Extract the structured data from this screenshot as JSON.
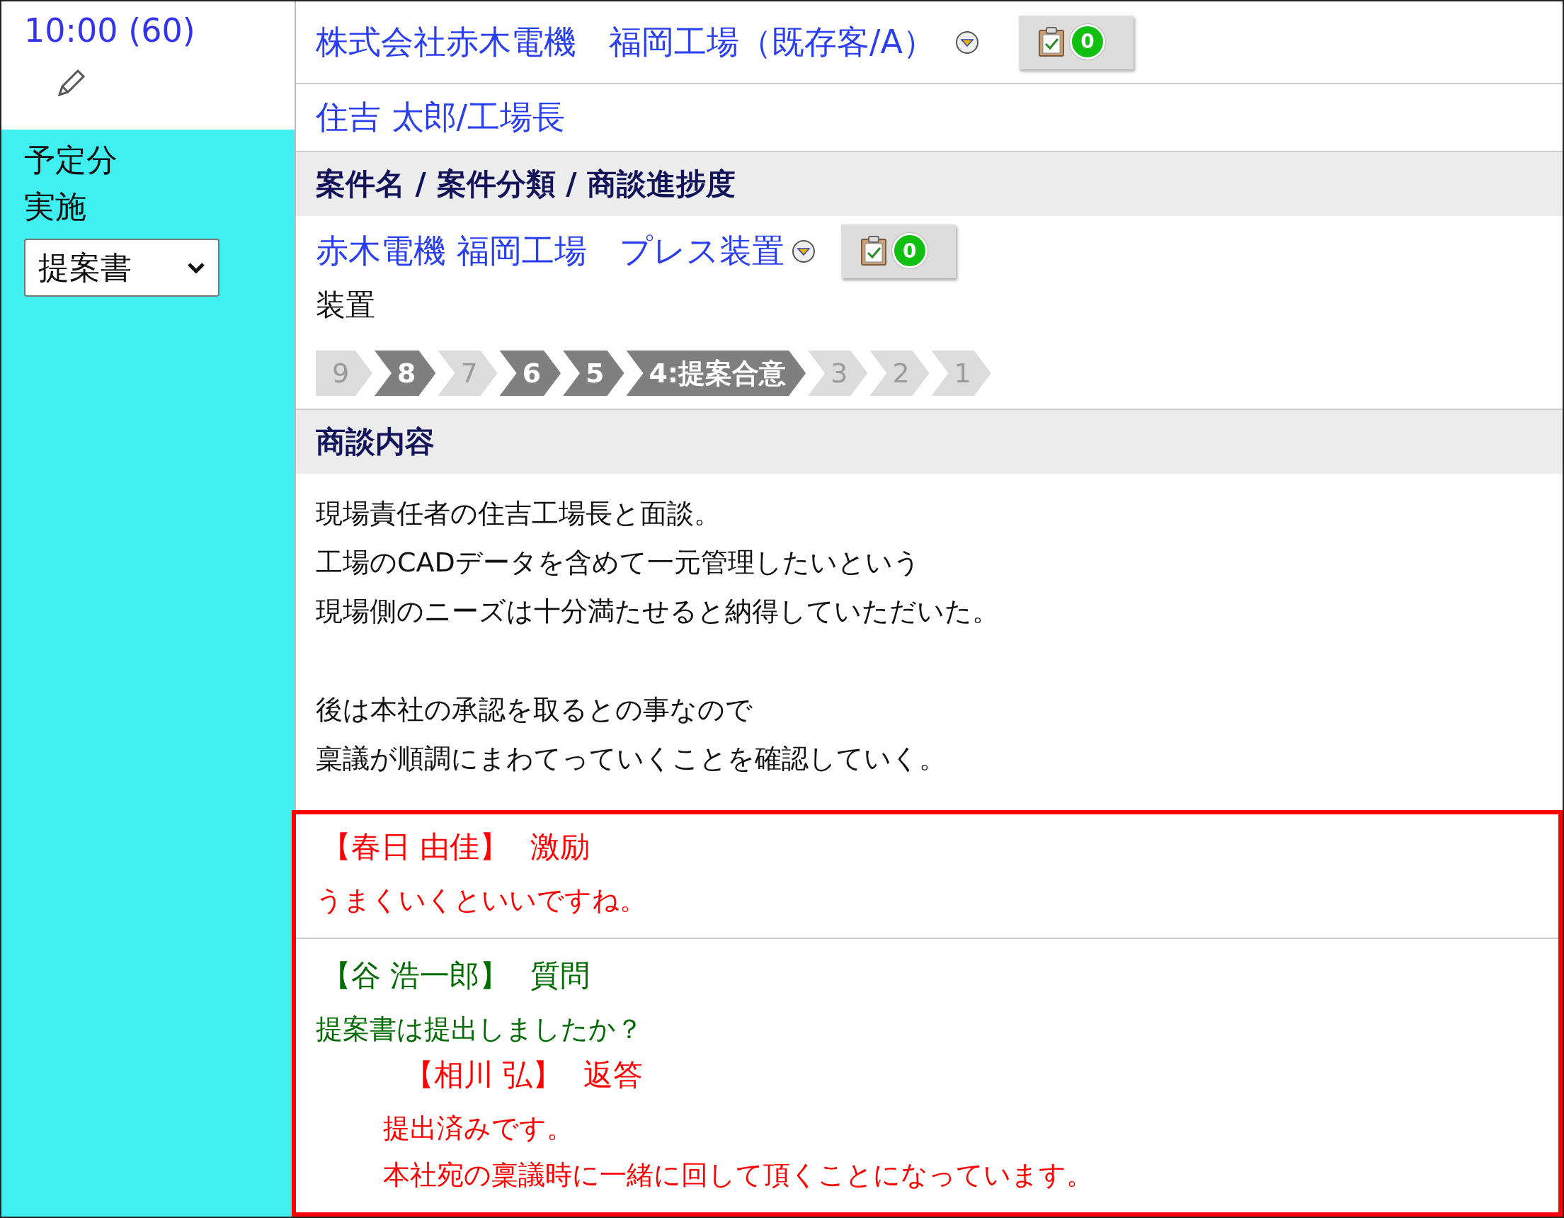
{
  "schedule": {
    "time": "10:00 (60)",
    "status_lines": [
      "予定分",
      "実施"
    ],
    "activity_select": {
      "value": "提案書"
    }
  },
  "customer": {
    "name": "株式会社赤木電機　福岡工場（既存客/A）",
    "task_count": "0"
  },
  "contact": "住吉 太郎/工場長",
  "project_header": "案件名 / 案件分類 / 商談進捗度",
  "project": {
    "name": "赤木電機 福岡工場　プレス装置",
    "task_count": "0",
    "category": "装置",
    "stages": [
      {
        "label": "9",
        "selected": false
      },
      {
        "label": "8",
        "selected": true
      },
      {
        "label": "7",
        "selected": false
      },
      {
        "label": "6",
        "selected": true
      },
      {
        "label": "5",
        "selected": true
      },
      {
        "label": "4:提案合意",
        "selected": true
      },
      {
        "label": "3",
        "selected": false
      },
      {
        "label": "2",
        "selected": false
      },
      {
        "label": "1",
        "selected": false
      }
    ]
  },
  "content_header": "商談内容",
  "content_paragraphs": [
    {
      "lines": [
        "現場責任者の住吉工場長と面談。",
        "工場のCADデータを含めて一元管理したいという",
        "現場側のニーズは十分満たせると納得していただいた。"
      ]
    },
    {
      "lines": [
        "後は本社の承認を取るとの事なので",
        "稟議が順調にまわてっていくことを確認していく。"
      ]
    }
  ],
  "comments": [
    {
      "author": "【春日 由佳】",
      "type": "激励",
      "color": "#ff0000",
      "lines": [
        "うまくいくといいですね。"
      ]
    },
    {
      "author": "【谷 浩一郎】",
      "type": "質問",
      "color": "#006b00",
      "lines": [
        "提案書は提出しましたか？"
      ],
      "children": [
        {
          "author": "【相川 弘】",
          "type": "返答",
          "color": "#ff0000",
          "lines": [
            "提出済みです。",
            "本社宛の稟議時に一緒に回して頂くことになっています。"
          ]
        }
      ]
    }
  ]
}
